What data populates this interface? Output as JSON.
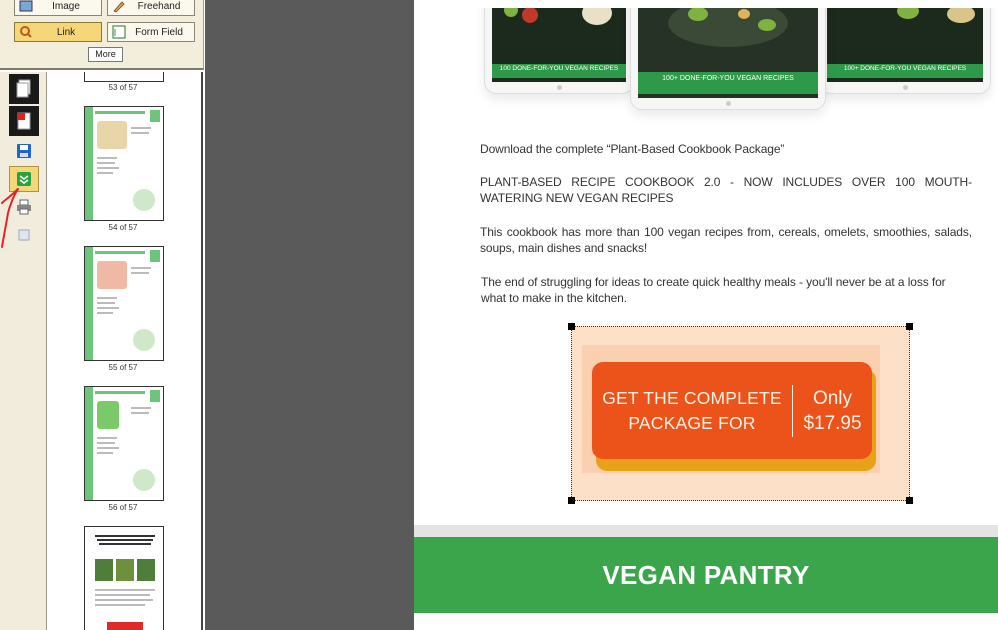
{
  "tools": {
    "image_label": "Image",
    "freehand_label": "Freehand",
    "link_label": "Link",
    "formfield_label": "Form Field",
    "more_label": "More"
  },
  "strip": {
    "icons": [
      "pages-icon",
      "pdf-icon",
      "save-icon",
      "download-icon",
      "print-icon",
      "blank-page-icon"
    ]
  },
  "thumbnails": [
    {
      "label": "53 of 57"
    },
    {
      "label": "54 of 57"
    },
    {
      "label": "55 of 57"
    },
    {
      "label": "56 of 57"
    }
  ],
  "document": {
    "tablet_banners": [
      "100 DONE-FOR-YOU VEGAN RECIPES",
      "100+ DONE-FOR-YOU VEGAN RECIPES",
      "100+ DONE-FOR-YOU VEGAN RECIPES"
    ],
    "paragraphs": [
      "Download the complete “Plant-Based Cookbook Package”",
      "PLANT-BASED RECIPE COOKBOOK 2.0 - NOW INCLUDES OVER 100 MOUTH-WATERING NEW VEGAN RECIPES",
      "This cookbook has more than 100 vegan recipes from, cereals, omelets, smoothies, salads, soups, main dishes and snacks!",
      "The end of struggling for ideas to create quick healthy meals - you'll never be at a loss for what to make in the kitchen."
    ],
    "cta": {
      "line1": "GET THE COMPLETE",
      "line2": "PACKAGE FOR",
      "only": "Only",
      "price": "$17.95"
    },
    "section_heading": "VEGAN PANTRY"
  },
  "colors": {
    "accent_green": "#3aa54a",
    "cta_orange": "#ec531a",
    "selected_tool": "#f5d77a"
  }
}
